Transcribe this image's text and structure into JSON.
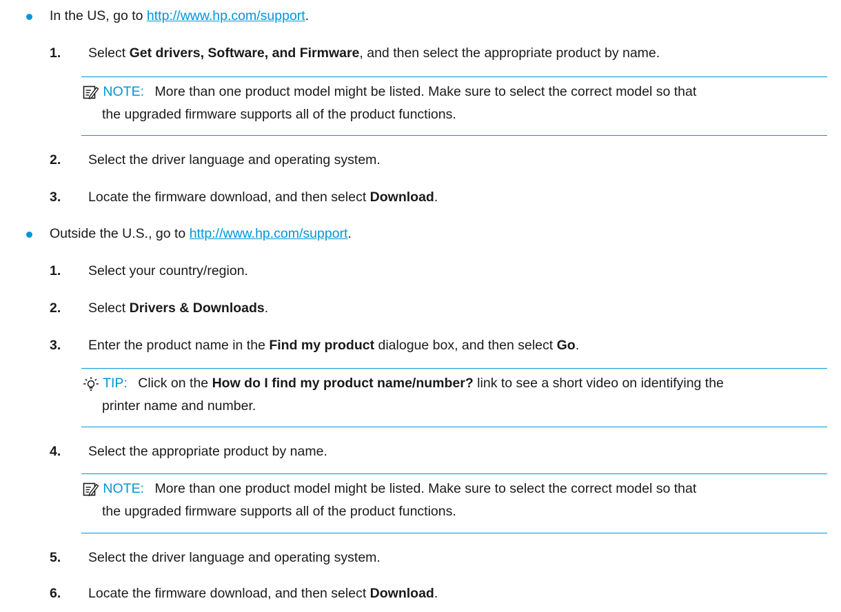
{
  "us": {
    "lead": "In the US, go to ",
    "link": "http://www.hp.com/support",
    "trail": ".",
    "steps": [
      {
        "num": "1.",
        "pre": "Select ",
        "bold": "Get drivers, Software, and Firmware",
        "post": ", and then select the appropriate product by name."
      },
      {
        "num": "2.",
        "text": "Select the driver language and operating system."
      },
      {
        "num": "3.",
        "pre": "Locate the firmware download, and then select ",
        "bold": "Download",
        "post": "."
      }
    ],
    "note": {
      "icon": "note-icon",
      "label": "NOTE:",
      "line1": "More than one product model might be listed. Make sure to select the correct model so that",
      "line2": "the upgraded firmware supports all of the product functions."
    }
  },
  "outside": {
    "lead": "Outside the U.S., go to ",
    "link": "http://www.hp.com/support",
    "trail": ".",
    "steps": [
      {
        "num": "1.",
        "text": "Select your country/region."
      },
      {
        "num": "2.",
        "pre": "Select ",
        "bold": "Drivers & Downloads",
        "post": "."
      },
      {
        "num": "3.",
        "pre": "Enter the product name in the ",
        "bold": "Find my product",
        "mid": " dialogue box, and then select ",
        "bold2": "Go",
        "post": "."
      },
      {
        "num": "4.",
        "text": "Select the appropriate product by name."
      },
      {
        "num": "5.",
        "text": "Select the driver language and operating system."
      },
      {
        "num": "6.",
        "pre": "Locate the firmware download, and then select ",
        "bold": "Download",
        "post": "."
      }
    ],
    "tip": {
      "icon": "lightbulb-icon",
      "label": "TIP:",
      "pre": "Click on the ",
      "bold": "How do I find my product name/number?",
      "post": " link to see a short video on identifying the",
      "line2": "printer name and number."
    },
    "note": {
      "icon": "note-icon",
      "label": "NOTE:",
      "line1": "More than one product model might be listed. Make sure to select the correct model so that",
      "line2": "the upgraded firmware supports all of the product functions."
    }
  },
  "colors": {
    "accent": "#0096d6",
    "text": "#1a1a1a"
  }
}
